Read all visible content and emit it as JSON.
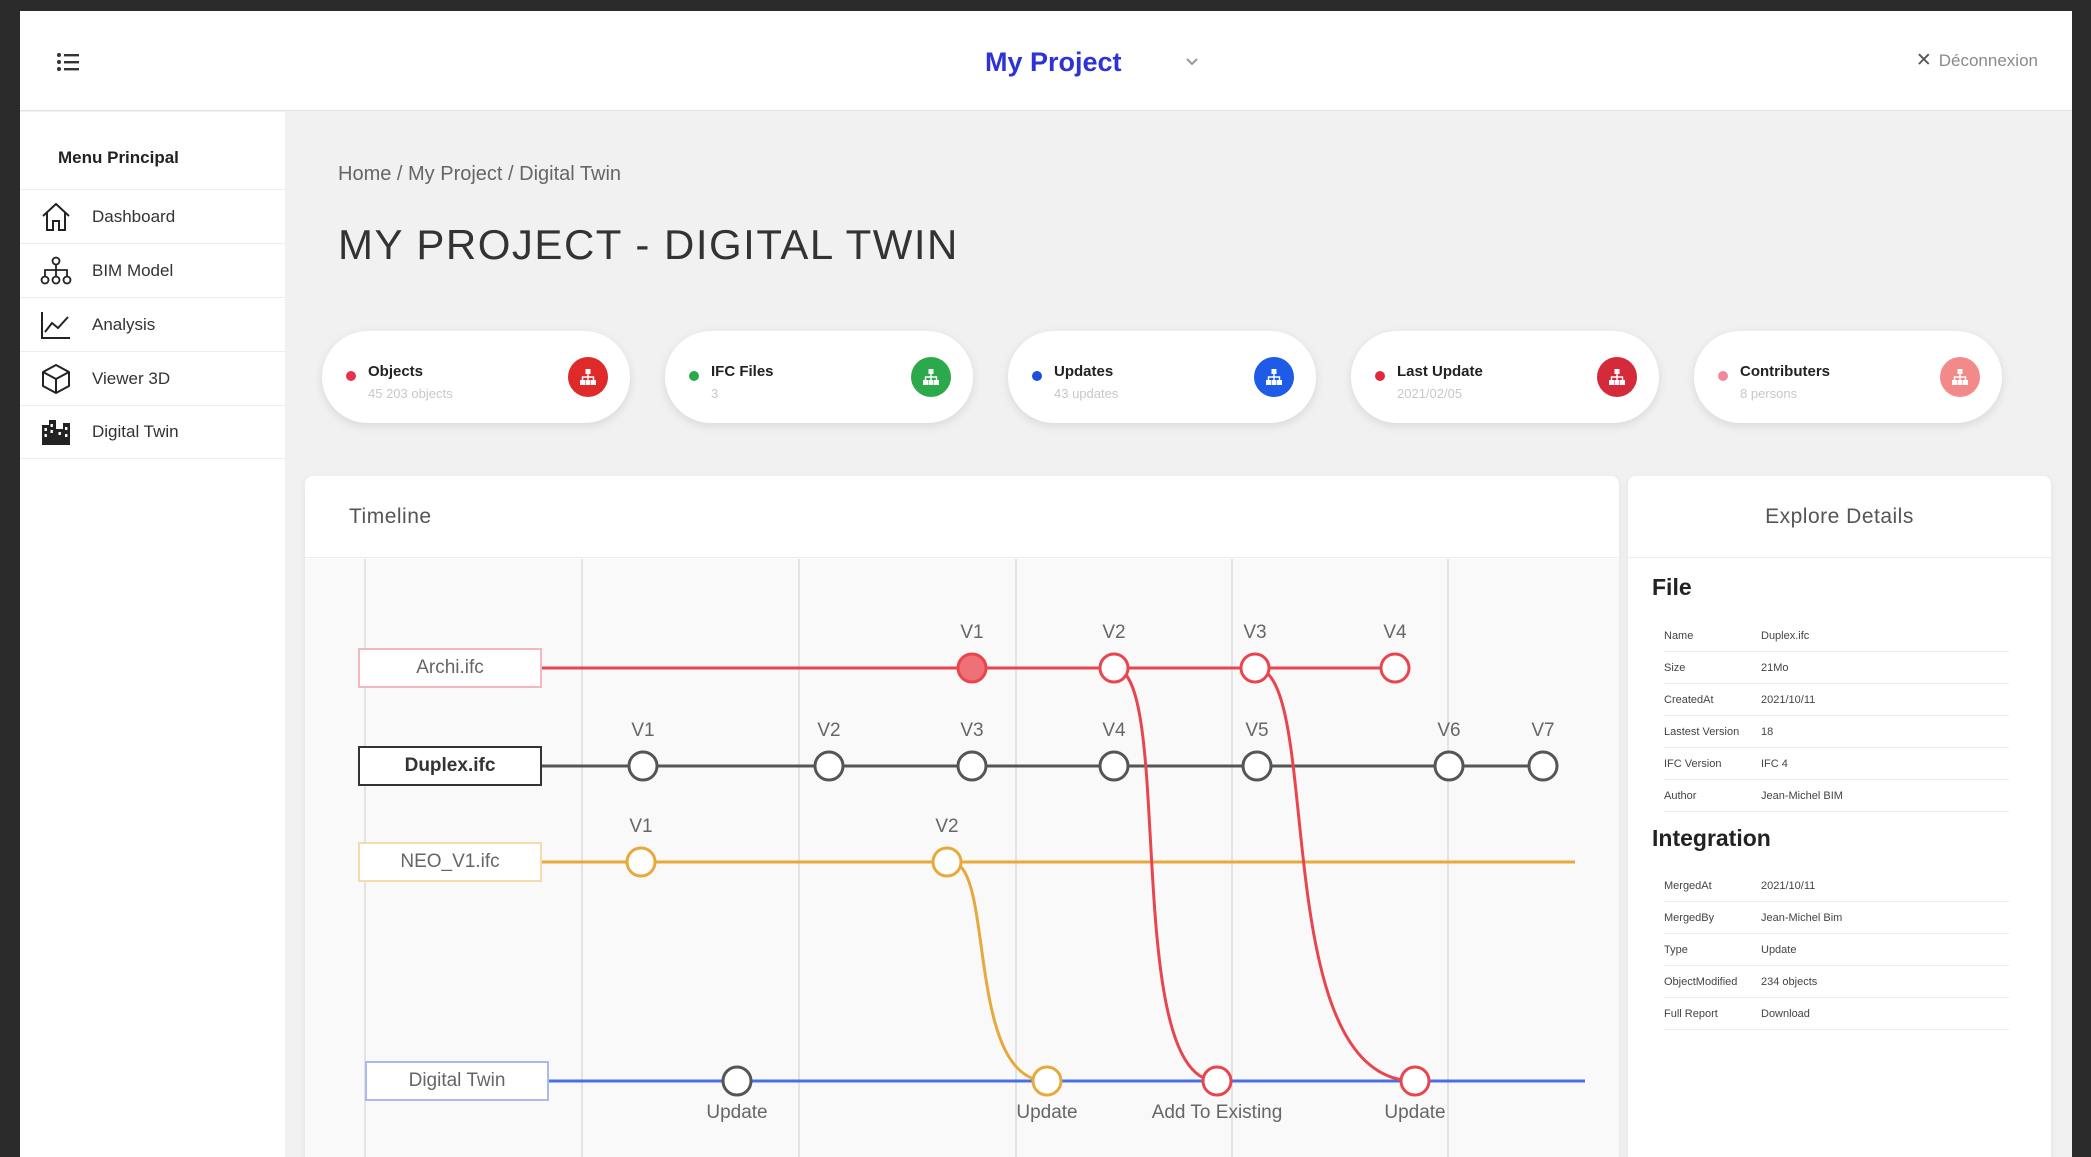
{
  "header": {
    "project_title": "My Project",
    "logout_label": "Déconnexion"
  },
  "sidebar": {
    "title": "Menu Principal",
    "items": [
      {
        "label": "Dashboard",
        "icon": "home-icon"
      },
      {
        "label": "BIM Model",
        "icon": "hierarchy-icon"
      },
      {
        "label": "Analysis",
        "icon": "chart-line-icon"
      },
      {
        "label": "Viewer 3D",
        "icon": "cube-icon"
      },
      {
        "label": "Digital Twin",
        "icon": "buildings-icon"
      }
    ]
  },
  "breadcrumb": "Home / My Project / Digital Twin",
  "page_title": "MY PROJECT - DIGITAL TWIN",
  "stats": [
    {
      "label": "Objects",
      "value": "45 203 objects",
      "dot_color": "#e8324a",
      "badge_color": "#e02a2a"
    },
    {
      "label": "IFC Files",
      "value": "3",
      "dot_color": "#2ca94a",
      "badge_color": "#2ca94a"
    },
    {
      "label": "Updates",
      "value": "43 updates",
      "dot_color": "#1e4fd8",
      "badge_color": "#1e5be6"
    },
    {
      "label": "Last Update",
      "value": "2021/02/05",
      "dot_color": "#e02a3a",
      "badge_color": "#d42a3a"
    },
    {
      "label": "Contributers",
      "value": "8 persons",
      "dot_color": "#f08a9a",
      "badge_color": "#f28a8a"
    }
  ],
  "timeline": {
    "title": "Timeline",
    "colors": {
      "archi": "#e8464f",
      "duplex": "#555555",
      "neo": "#e8a93c",
      "twin": "#4a6ee8"
    },
    "tracks": [
      {
        "file": "Archi.ifc",
        "versions": [
          "V1",
          "V2",
          "V3",
          "V4"
        ]
      },
      {
        "file": "Duplex.ifc",
        "versions": [
          "V1",
          "V2",
          "V3",
          "V4",
          "V5",
          "V6",
          "V7"
        ]
      },
      {
        "file": "NEO_V1.ifc",
        "versions": [
          "V1",
          "V2"
        ]
      },
      {
        "file": "Digital Twin",
        "events": [
          "Update",
          "Update",
          "Add To Existing",
          "Update"
        ]
      }
    ]
  },
  "details": {
    "title": "Explore Details",
    "file": {
      "title": "File",
      "rows": [
        {
          "key": "Name",
          "value": "Duplex.ifc"
        },
        {
          "key": "Size",
          "value": "21Mo"
        },
        {
          "key": "CreatedAt",
          "value": "2021/10/11"
        },
        {
          "key": "Lastest Version",
          "value": "18"
        },
        {
          "key": "IFC Version",
          "value": "IFC 4"
        },
        {
          "key": "Author",
          "value": "Jean-Michel BIM"
        }
      ]
    },
    "integration": {
      "title": "Integration",
      "rows": [
        {
          "key": "MergedAt",
          "value": "2021/10/11"
        },
        {
          "key": "MergedBy",
          "value": "Jean-Michel Bim"
        },
        {
          "key": "Type",
          "value": "Update"
        },
        {
          "key": "ObjectModified",
          "value": "234 objects"
        },
        {
          "key": "Full Report",
          "value": "Download"
        }
      ]
    }
  }
}
